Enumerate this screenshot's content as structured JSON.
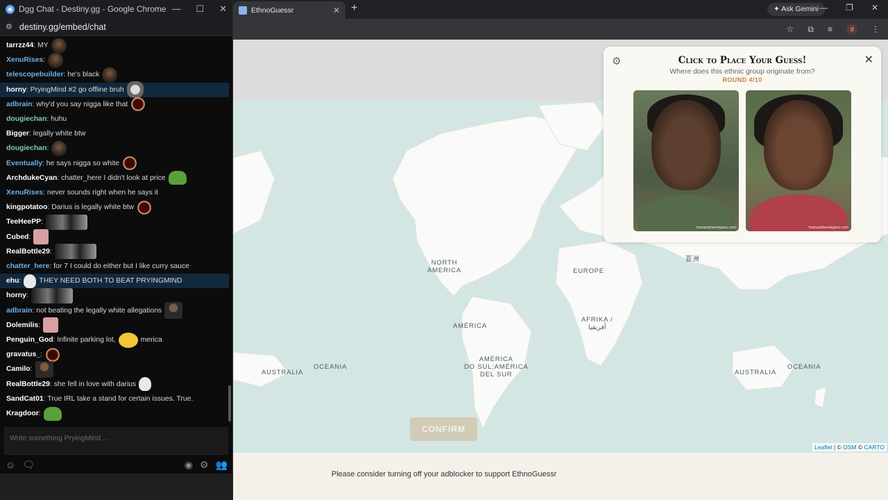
{
  "chat_window": {
    "title": "Dgg Chat - Destiny.gg - Google Chrome",
    "url": "destiny.gg/embed/chat",
    "input_placeholder": "Write something PryingMind ...",
    "messages": [
      {
        "user": "tarrzz44",
        "color": "#ffffff",
        "text": ": MY",
        "emote": "face"
      },
      {
        "user": "XenuRises",
        "color": "#6ab0e8",
        "text": ":",
        "emote": "face"
      },
      {
        "user": "telescopebuilder",
        "color": "#6ab0e8",
        "text": ": he's black",
        "emote": "face"
      },
      {
        "user": "horny",
        "color": "#ffffff",
        "text": ": PryingMind #2 go offline bruh",
        "emote": "angel",
        "highlight": true
      },
      {
        "user": "adbrain",
        "color": "#6ab0e8",
        "text": ": why'd you say nigga like that",
        "emote": "ring"
      },
      {
        "user": "dougiechan",
        "color": "#7fd1a8",
        "text": ": huhu",
        "emote": ""
      },
      {
        "user": "Bigger",
        "color": "#ffffff",
        "text": ": legally white btw",
        "emote": ""
      },
      {
        "user": "dougiechan",
        "color": "#7fd1a8",
        "text": ":",
        "emote": "face"
      },
      {
        "user": "Eventually",
        "color": "#6ab0e8",
        "text": ": he says nigga so white",
        "emote": "ring"
      },
      {
        "user": "ArchdukeCyan",
        "color": "#ffffff",
        "text": ": chatter_here I didn't look at price",
        "emote": "frog"
      },
      {
        "user": "XenuRises",
        "color": "#6ab0e8",
        "text": ": never sounds right when he says it",
        "emote": ""
      },
      {
        "user": "kingpotatoo",
        "color": "#ffffff",
        "text": ": Darius is legally white btw",
        "emote": "ring"
      },
      {
        "user": "TeeHeePP",
        "color": "#ffffff",
        "text": ":",
        "emote": "bw"
      },
      {
        "user": "Cubed",
        "color": "#ffffff",
        "text": ":",
        "emote": "pink"
      },
      {
        "user": "RealBottle29",
        "color": "#ffffff",
        "text": ":",
        "emote": "bw"
      },
      {
        "user": "chatter_here",
        "color": "#6ab0e8",
        "text": ": for 7 I could do either but I like curry sauce",
        "emote": ""
      },
      {
        "user": "ehu",
        "color": "#ffffff",
        "text": ":",
        "emote": "skull",
        "extra": "THEY NEED BOTH TO BEAT PRYINGMIND",
        "highlight": true
      },
      {
        "user": "horny",
        "color": "#ffffff",
        "text": ":",
        "emote": "bw"
      },
      {
        "user": "adbrain",
        "color": "#6ab0e8",
        "text": ": not beating the legally white allegations",
        "emote": "man"
      },
      {
        "user": "Dolemilis",
        "color": "#ffffff",
        "text": ":",
        "emote": "pink"
      },
      {
        "user": "Penguin_God",
        "color": "#ffffff",
        "text": ": Infinite parking lot,",
        "emote": "duck",
        "extra": "merica"
      },
      {
        "user": "gravatus_",
        "color": "#ffffff",
        "text": ":",
        "emote": "ring"
      },
      {
        "user": "Camilo",
        "color": "#ffffff",
        "text": ":",
        "emote": "man"
      },
      {
        "user": "RealBottle29",
        "color": "#ffffff",
        "text": ": she fell in love with darius",
        "emote": "skull"
      },
      {
        "user": "SandCat01",
        "color": "#ffffff",
        "text": ": True IRL take a stand for certain issues. True.",
        "emote": ""
      },
      {
        "user": "Kragdoor",
        "color": "#ffffff",
        "text": ":",
        "emote": "frog"
      }
    ]
  },
  "browser": {
    "tab_title": "EthnoGuessr",
    "ask_gemini": "Ask Gemini",
    "profile_letter": "d"
  },
  "game": {
    "title": "Click to Place Your Guess!",
    "subtitle": "Where does this ethnic group originate from?",
    "round": "ROUND 4/10",
    "photo_watermark": "humanphenotypes.com",
    "confirm_label": "CONFIRM",
    "ad_note": "Please consider turning off your adblocker to support EthnoGuessr",
    "attribution": {
      "leaflet": "Leaflet",
      "sep1": " | © ",
      "osm": "OSM",
      "sep2": " © ",
      "carto": "CARTO"
    }
  },
  "map_labels": {
    "north_america": "NORTH\nAMERICA",
    "europe": "EUROPE",
    "asia": "亚洲",
    "america": "AMÉRICA",
    "afrika": "AFRIKA /\nأفريقيا",
    "australia_left": "AUSTRALIA",
    "oceania_left": "OCEANIA",
    "south_america": "AMÉRICA\nDO SUL;AMÉRICA\nDEL SUR",
    "australia_right": "AUSTRALIA",
    "oceania_right": "OCEANIA"
  },
  "colors": {
    "ocean": "#d3e6e3",
    "land": "#fafaf8",
    "round_accent": "#c7813a",
    "confirm_disabled": "#d2cbb6",
    "chat_highlight": "#12283d"
  },
  "icons": [
    "gear-icon",
    "close-icon",
    "star-icon",
    "extensions-icon",
    "media-icon",
    "menu-icon",
    "emoji-icon",
    "whisper-icon",
    "eye-icon",
    "settings-icon",
    "users-icon"
  ]
}
